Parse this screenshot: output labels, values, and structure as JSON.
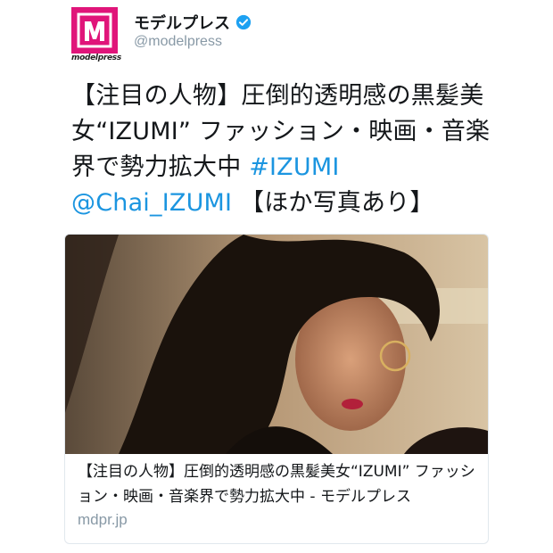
{
  "header": {
    "logo_word": "modelpress",
    "display_name": "モデルプレス",
    "handle": "@modelpress"
  },
  "tweet": {
    "text_main": "【注目の人物】圧倒的透明感の黒髪美女“IZUMI” ファッション・映画・音楽界で勢力拡大中 ",
    "hashtag": "#IZUMI",
    "mention": "@Chai_IZUMI",
    "text_tail": "【ほか写真あり】",
    "link_color": "#1b95e0"
  },
  "card": {
    "title": "【注目の人物】圧倒的透明感の黒髪美女“IZUMI” ファッション・映画・音楽界で勢力拡大中 - モデルプレス",
    "domain": "mdpr.jp",
    "photo_description_icon": "portrait-photo"
  },
  "colors": {
    "brand": "#e0157a",
    "verified": "#1da1f2",
    "text": "#14171a",
    "muted": "#8899a6"
  }
}
